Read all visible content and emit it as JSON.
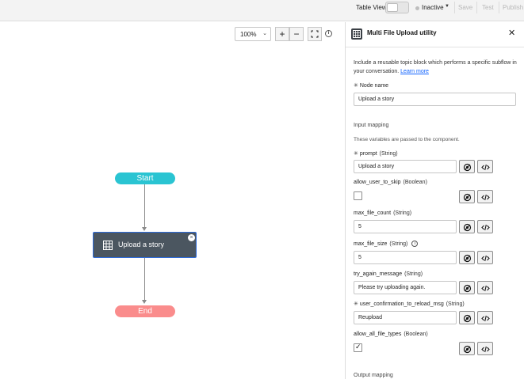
{
  "topbar": {
    "table_view_label": "Table View",
    "status_label": "Inactive",
    "save_label": "Save",
    "test_label": "Test",
    "publish_label": "Publish"
  },
  "canvas": {
    "zoom_value": "100%",
    "zoom_in_label": "+",
    "zoom_out_label": "−",
    "nodes": {
      "start": "Start",
      "main": "Upload a story",
      "end": "End"
    }
  },
  "panel": {
    "title": "Multi File Upload utility",
    "description": "Include a reusable topic block which performs a specific subflow in your conversation.",
    "learn_more": "Learn more",
    "node_name_label": "Node name",
    "node_name_value": "Upload a story",
    "input_mapping_title": "Input mapping",
    "input_mapping_sub": "These variables are passed to the component.",
    "output_mapping_title": "Output mapping",
    "fields": [
      {
        "name": "prompt",
        "type": "(String)",
        "value": "Upload a story"
      },
      {
        "name": "allow_user_to_skip",
        "type": "(Boolean)",
        "checked": false
      },
      {
        "name": "max_file_count",
        "type": "(String)",
        "value": "5"
      },
      {
        "name": "max_file_size",
        "type": "(String)",
        "value": "5"
      },
      {
        "name": "try_again_message",
        "type": "(String)",
        "value": "Please try uploading again."
      },
      {
        "name": "user_confirmation_to_reload_msg",
        "type": "(String)",
        "value": "Reupload"
      },
      {
        "name": "allow_all_file_types",
        "type": "(Boolean)",
        "checked": true
      }
    ]
  },
  "colors": {
    "start_node": "#2ac4d2",
    "end_node": "#fa8c8c",
    "main_node": "#4b5660",
    "link": "#0f62fe"
  }
}
